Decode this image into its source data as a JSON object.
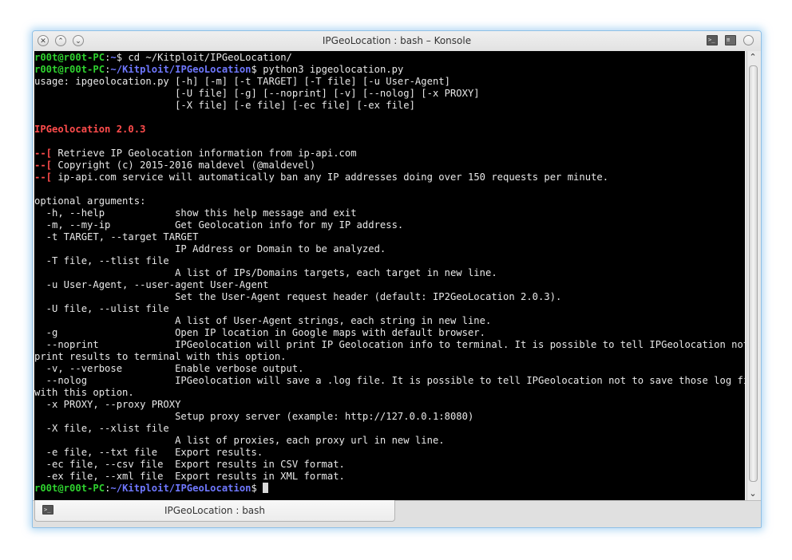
{
  "window": {
    "title": "IPGeoLocation : bash – Konsole",
    "buttons": {
      "close": "✕",
      "minimize": "⌃",
      "maximize": "⌄"
    }
  },
  "terminal": {
    "lines": [
      [
        [
          "g",
          "r00t@r00t-PC"
        ],
        [
          "w",
          ":"
        ],
        [
          "b",
          "~"
        ],
        [
          "w",
          "$ cd ~/Kitploit/IPGeoLocation/"
        ]
      ],
      [
        [
          "g",
          "r00t@r00t-PC"
        ],
        [
          "w",
          ":"
        ],
        [
          "b",
          "~/Kitploit/IPGeoLocation"
        ],
        [
          "w",
          "$ python3 ipgeolocation.py"
        ]
      ],
      [
        [
          "w",
          "usage: ipgeolocation.py [-h] [-m] [-t TARGET] [-T file] [-u User-Agent]"
        ]
      ],
      [
        [
          "w",
          "                        [-U file] [-g] [--noprint] [-v] [--nolog] [-x PROXY]"
        ]
      ],
      [
        [
          "w",
          "                        [-X file] [-e file] [-ec file] [-ex file]"
        ]
      ],
      [
        [
          "w",
          ""
        ]
      ],
      [
        [
          "r",
          "IPGeolocation 2.0.3"
        ]
      ],
      [
        [
          "w",
          ""
        ]
      ],
      [
        [
          "r",
          "--["
        ],
        [
          "w",
          " Retrieve IP Geolocation information from ip-api.com"
        ]
      ],
      [
        [
          "r",
          "--["
        ],
        [
          "w",
          " Copyright (c) 2015-2016 maldevel (@maldevel)"
        ]
      ],
      [
        [
          "r",
          "--["
        ],
        [
          "w",
          " ip-api.com service will automatically ban any IP addresses doing over 150 requests per minute."
        ]
      ],
      [
        [
          "w",
          ""
        ]
      ],
      [
        [
          "w",
          "optional arguments:"
        ]
      ],
      [
        [
          "w",
          "  -h, --help            show this help message and exit"
        ]
      ],
      [
        [
          "w",
          "  -m, --my-ip           Get Geolocation info for my IP address."
        ]
      ],
      [
        [
          "w",
          "  -t TARGET, --target TARGET"
        ]
      ],
      [
        [
          "w",
          "                        IP Address or Domain to be analyzed."
        ]
      ],
      [
        [
          "w",
          "  -T file, --tlist file"
        ]
      ],
      [
        [
          "w",
          "                        A list of IPs/Domains targets, each target in new line."
        ]
      ],
      [
        [
          "w",
          "  -u User-Agent, --user-agent User-Agent"
        ]
      ],
      [
        [
          "w",
          "                        Set the User-Agent request header (default: IP2GeoLocation 2.0.3)."
        ]
      ],
      [
        [
          "w",
          "  -U file, --ulist file"
        ]
      ],
      [
        [
          "w",
          "                        A list of User-Agent strings, each string in new line."
        ]
      ],
      [
        [
          "w",
          "  -g                    Open IP location in Google maps with default browser."
        ]
      ],
      [
        [
          "w",
          "  --noprint             IPGeolocation will print IP Geolocation info to terminal. It is possible to tell IPGeolocation not to"
        ]
      ],
      [
        [
          "w",
          "print results to terminal with this option."
        ]
      ],
      [
        [
          "w",
          "  -v, --verbose         Enable verbose output."
        ]
      ],
      [
        [
          "w",
          "  --nolog               IPGeolocation will save a .log file. It is possible to tell IPGeolocation not to save those log files"
        ]
      ],
      [
        [
          "w",
          "with this option."
        ]
      ],
      [
        [
          "w",
          "  -x PROXY, --proxy PROXY"
        ]
      ],
      [
        [
          "w",
          "                        Setup proxy server (example: http://127.0.0.1:8080)"
        ]
      ],
      [
        [
          "w",
          "  -X file, --xlist file"
        ]
      ],
      [
        [
          "w",
          "                        A list of proxies, each proxy url in new line."
        ]
      ],
      [
        [
          "w",
          "  -e file, --txt file   Export results."
        ]
      ],
      [
        [
          "w",
          "  -ec file, --csv file  Export results in CSV format."
        ]
      ],
      [
        [
          "w",
          "  -ex file, --xml file  Export results in XML format."
        ]
      ],
      [
        [
          "g",
          "r00t@r00t-PC"
        ],
        [
          "w",
          ":"
        ],
        [
          "b",
          "~/Kitploit/IPGeoLocation"
        ],
        [
          "w",
          "$ "
        ]
      ]
    ]
  },
  "scrollbar": {
    "up": "⌃",
    "down": "⌄"
  },
  "tabs": [
    {
      "label": "IPGeoLocation : bash",
      "active": true
    }
  ],
  "colors": {
    "prompt_user": "#2fd22f",
    "prompt_path": "#6f78ff",
    "banner": "#ff4c4c",
    "text": "#d9d9d9",
    "background": "#000000",
    "window_glow": "#8ec0e6"
  },
  "icons": [
    "close-icon",
    "minimize-icon",
    "maximize-icon",
    "terminal-icon",
    "menu-icon",
    "scroll-up-icon",
    "scroll-down-icon"
  ]
}
